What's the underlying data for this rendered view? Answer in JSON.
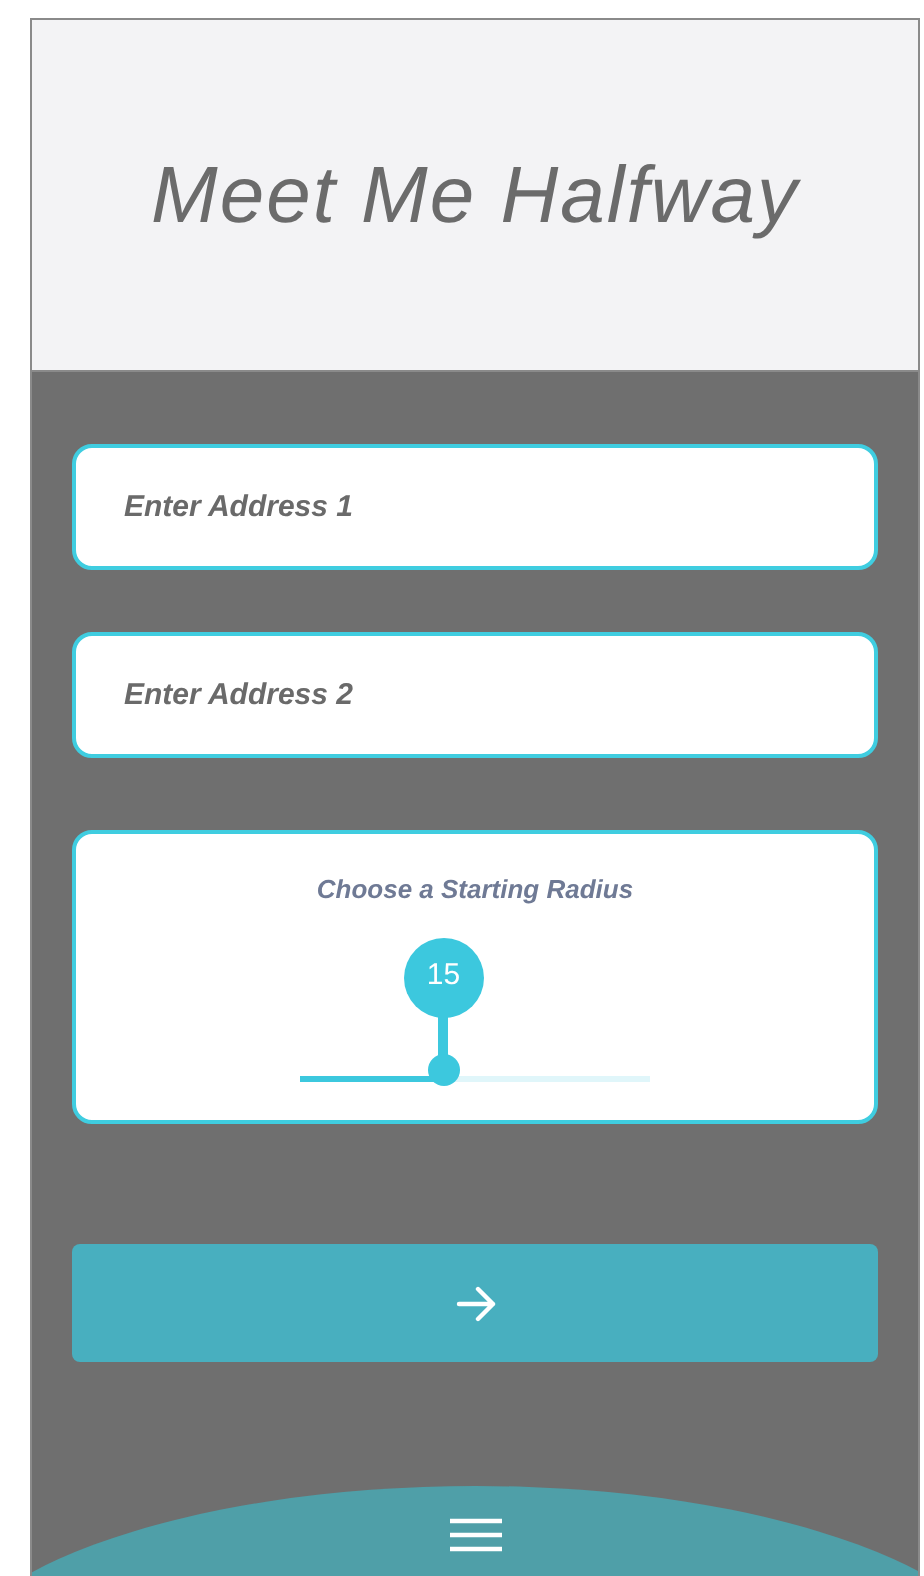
{
  "header": {
    "title": "Meet Me Halfway"
  },
  "address_fields": [
    {
      "placeholder": "Enter Address 1"
    },
    {
      "placeholder": "Enter Address 2"
    }
  ],
  "radius": {
    "label": "Choose a Starting Radius",
    "value": "15",
    "level": 0.41
  }
}
